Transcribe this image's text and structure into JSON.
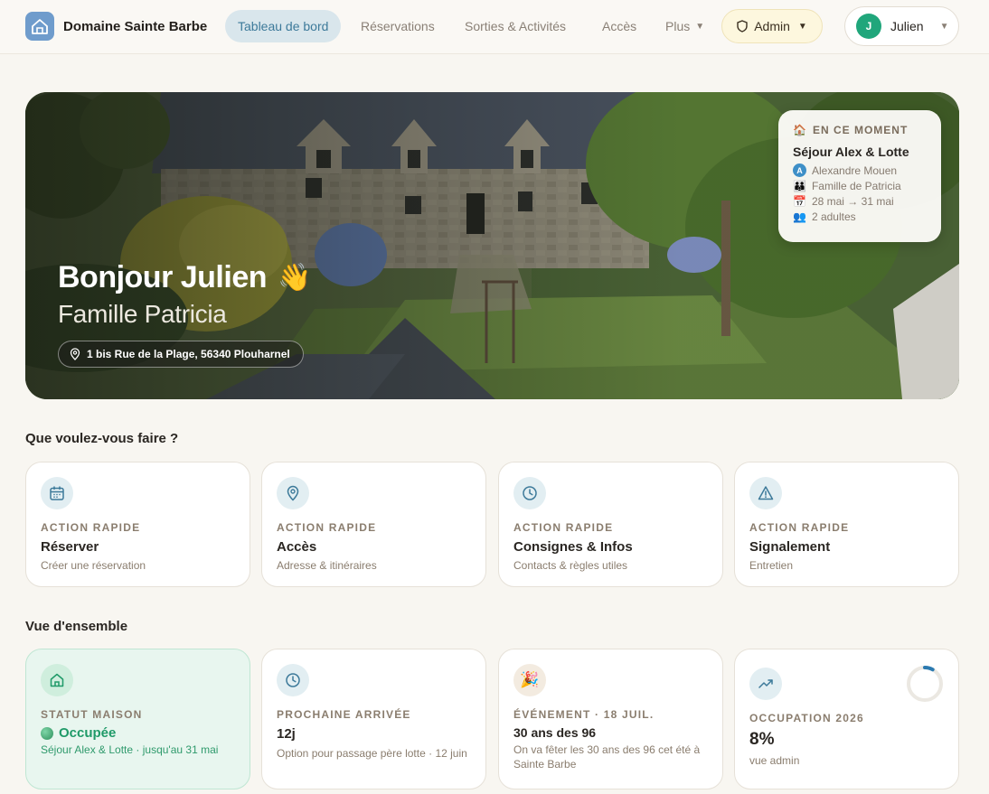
{
  "brand": {
    "name": "Domaine Sainte Barbe"
  },
  "nav": {
    "links": [
      "Tableau de bord",
      "Réservations",
      "Sorties & Activités",
      "Accès",
      "Plus"
    ],
    "admin_label": "Admin",
    "user_name": "Julien",
    "user_initial": "J"
  },
  "hero": {
    "greeting": "Bonjour Julien",
    "wave": "👋",
    "subtitle": "Famille Patricia",
    "address": "1 bis Rue de la Plage, 56340 Plouharnel",
    "now": {
      "label": "EN CE MOMENT",
      "label_icon": "🏠",
      "title": "Séjour Alex & Lotte",
      "person_initial": "A",
      "person": "Alexandre Mouen",
      "family_icon": "👪",
      "family": "Famille de Patricia",
      "calendar_icon": "📅",
      "dates": "28 mai → 31 mai",
      "people_icon": "👥",
      "guests": "2 adultes"
    }
  },
  "actions": {
    "title": "Que voulez-vous faire ?",
    "items": [
      {
        "kicker": "ACTION RAPIDE",
        "title": "Réserver",
        "desc": "Créer une réservation"
      },
      {
        "kicker": "ACTION RAPIDE",
        "title": "Accès",
        "desc": "Adresse & itinéraires"
      },
      {
        "kicker": "ACTION RAPIDE",
        "title": "Consignes & Infos",
        "desc": "Contacts & règles utiles"
      },
      {
        "kicker": "ACTION RAPIDE",
        "title": "Signalement",
        "desc": "Entretien"
      }
    ]
  },
  "overview": {
    "title": "Vue d'ensemble",
    "status": {
      "kicker": "STATUT MAISON",
      "title": "Occupée",
      "desc": "Séjour Alex & Lotte · jusqu'au 31 mai"
    },
    "arrival": {
      "kicker": "PROCHAINE ARRIVÉE",
      "title": "12j",
      "desc": "Option pour passage père lotte · 12 juin"
    },
    "event": {
      "kicker": "ÉVÉNEMENT · 18 JUIL.",
      "icon": "🎉",
      "title": "30 ans des 96",
      "desc": "On va fêter les 30 ans des 96 cet été à Sainte Barbe"
    },
    "occupancy": {
      "kicker": "OCCUPATION 2026",
      "title": "8%",
      "desc": "vue admin",
      "percent": 8
    }
  },
  "colors": {
    "accent": "#3d7a9a",
    "brand": "#6f9ccc",
    "success": "#1f9a68",
    "admin_bg": "#fdf7de"
  }
}
